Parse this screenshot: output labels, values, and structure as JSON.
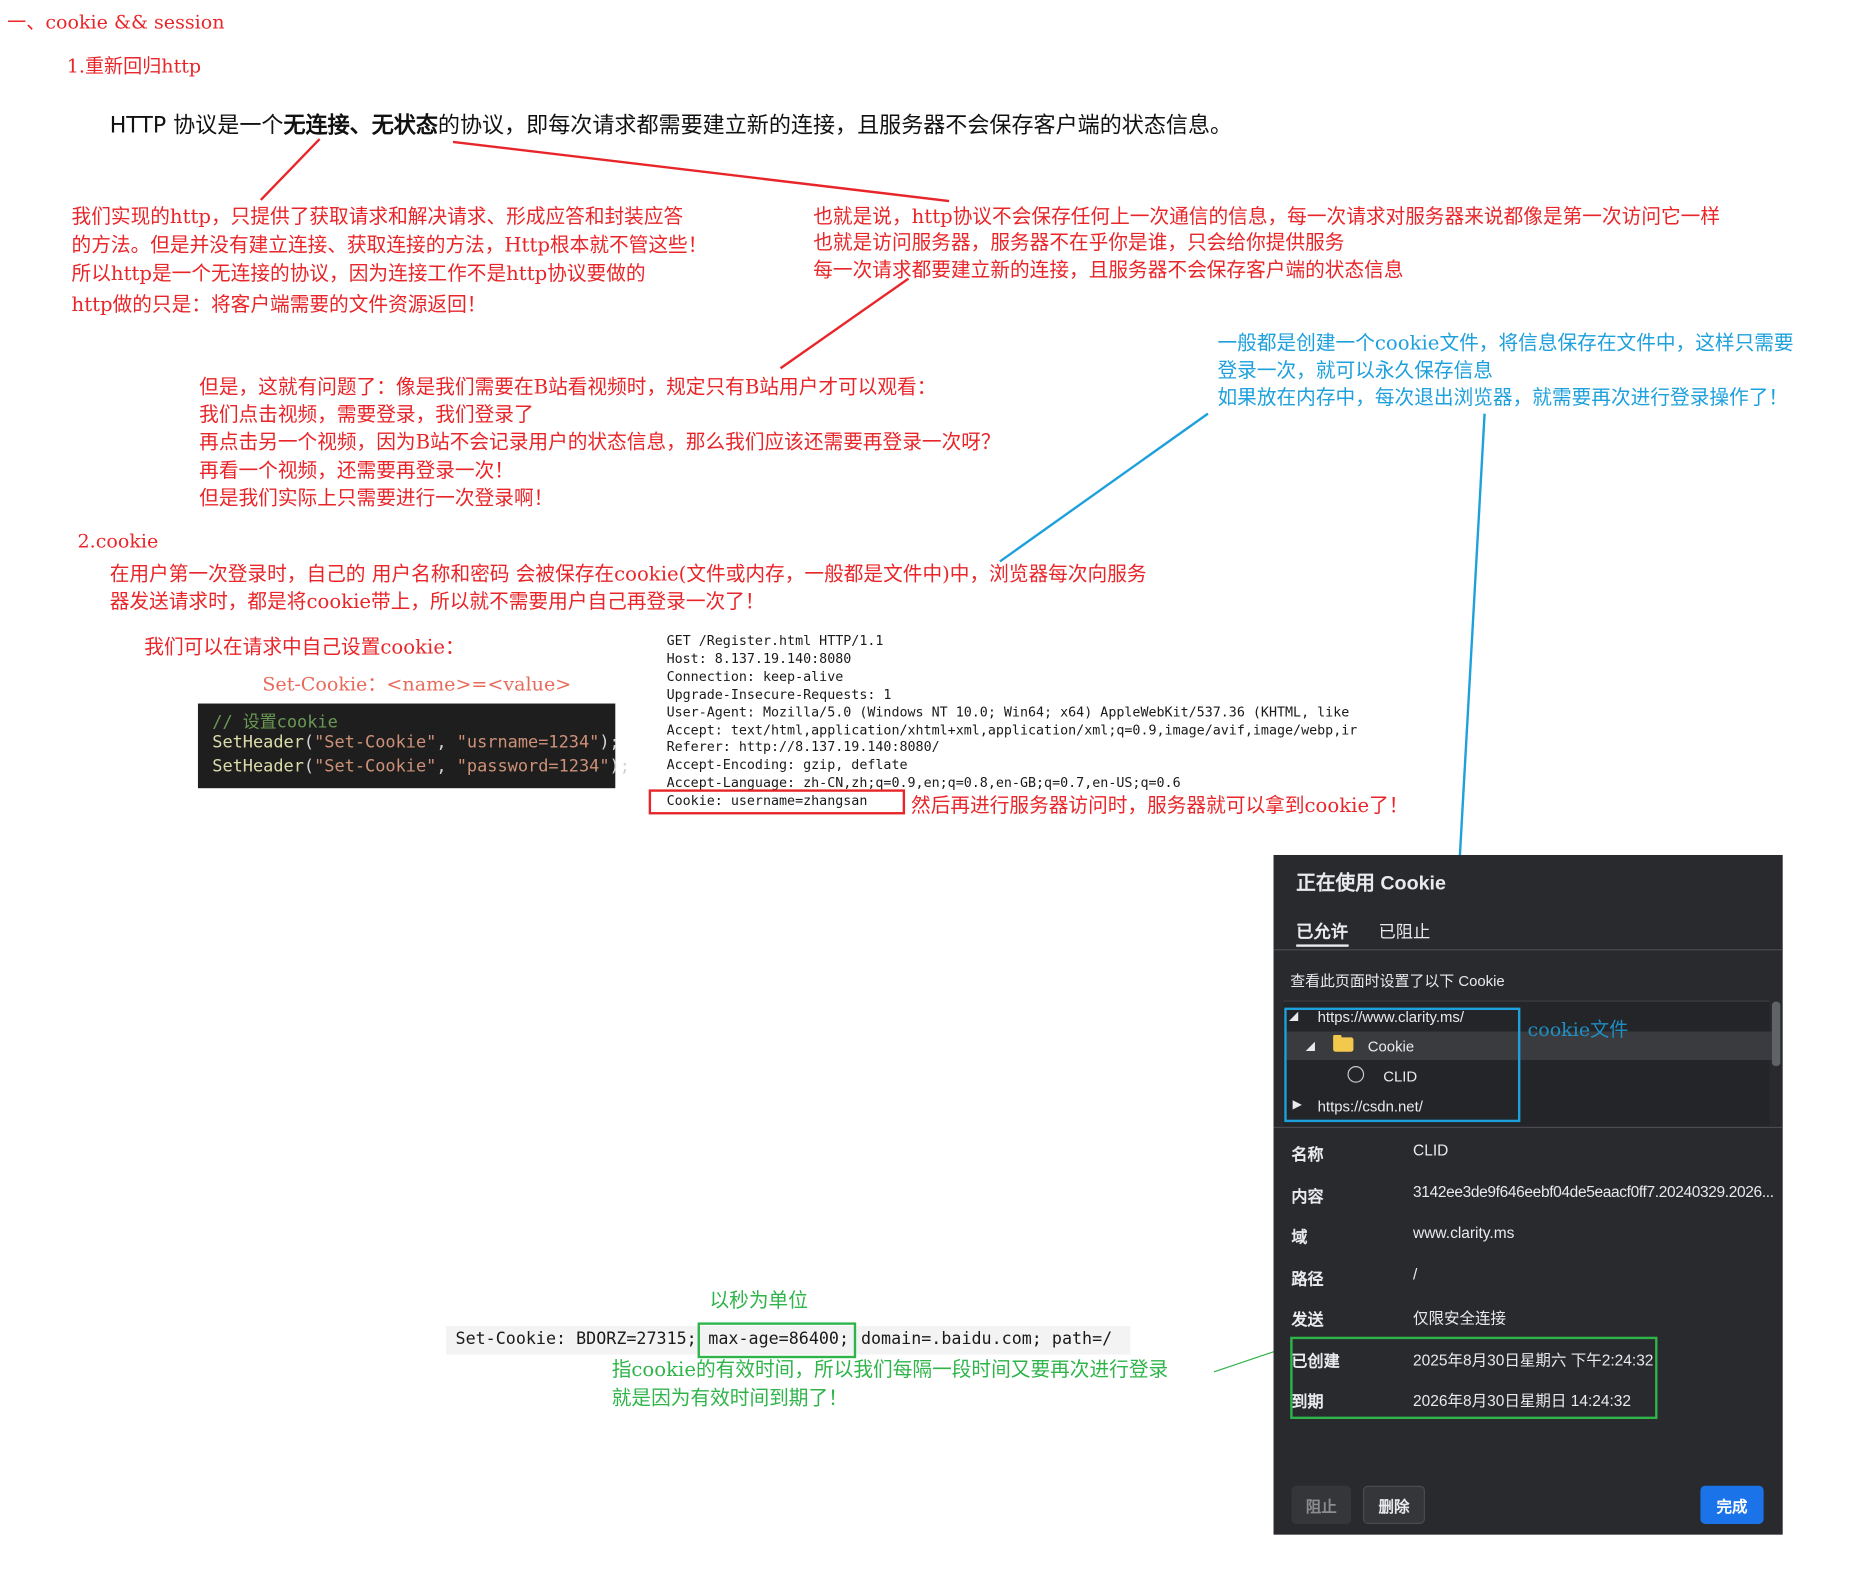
{
  "doc": {
    "heading": "一、cookie && session",
    "sub1": "1.重新回归http",
    "intro_a": "HTTP 协议是一个",
    "intro_b": "无连接、无状态",
    "intro_c": "的协议，即每次请求都需要建立新的连接，且服务器不会保存客户端的状态信息。",
    "note_left": [
      "我们实现的http，只提供了获取请求和解决请求、形成应答和封装应答",
      "的方法。但是并没有建立连接、获取连接的方法，Http根本就不管这些！",
      "所以http是一个无连接的协议，因为连接工作不是http协议要做的",
      "http做的只是：将客户端需要的文件资源返回！"
    ],
    "note_right": [
      "也就是说，http协议不会保存任何上一次通信的信息，每一次请求对服务器来说都像是第一次访问它一样",
      "也就是访问服务器，服务器不在乎你是谁，只会给你提供服务",
      "每一次请求都要建立新的连接，且服务器不会保存客户端的状态信息"
    ],
    "note_blue": [
      "一般都是创建一个cookie文件，将信息保存在文件中，这样只需要",
      "登录一次，就可以永久保存信息",
      "如果放在内存中，每次退出浏览器，就需要再次进行登录操作了！"
    ],
    "note_bili": [
      "但是，这就有问题了：像是我们需要在B站看视频时，规定只有B站用户才可以观看：",
      "我们点击视频，需要登录，我们登录了",
      "再点击另一个视频，因为B站不会记录用户的状态信息，那么我们应该还需要再登录一次呀？",
      "再看一个视频，还需要再登录一次！",
      "但是我们实际上只需要进行一次登录啊！"
    ],
    "sub2": "2.cookie",
    "cookie_desc": [
      "在用户第一次登录时，自己的 用户名称和密码 会被保存在cookie(文件或内存，一般都是文件中)中，浏览器每次向服务",
      "器发送请求时，都是将cookie带上，所以就不需要用户自己再登录一次了！"
    ],
    "set_self": "我们可以在请求中自己设置cookie：",
    "set_syntax": "Set-Cookie：<name>=<value>",
    "code": {
      "comment": "// 设置cookie",
      "fn": "SetHeader",
      "line2": [
        "(",
        "\"Set-Cookie\"",
        ", ",
        "\"usrname=1234\"",
        ");"
      ],
      "line3": [
        "(",
        "\"Set-Cookie\"",
        ", ",
        "\"password=1234\"",
        ");"
      ]
    },
    "http_request": [
      "GET /Register.html HTTP/1.1",
      "Host: 8.137.19.140:8080",
      "Connection: keep-alive",
      "Upgrade-Insecure-Requests: 1",
      "User-Agent: Mozilla/5.0 (Windows NT 10.0; Win64; x64) AppleWebKit/537.36 (KHTML, like",
      "Accept: text/html,application/xhtml+xml,application/xml;q=0.9,image/avif,image/webp,ir",
      "Referer: http://8.137.19.140:8080/",
      "Accept-Encoding: gzip, deflate",
      "Accept-Language: zh-CN,zh;q=0.9,en;q=0.8,en-GB;q=0.7,en-US;q=0.6",
      "Cookie: username=zhangsan"
    ],
    "after_note": "然后再进行服务器访问时，服务器就可以拿到cookie了！",
    "seconds_note": "以秒为单位",
    "set_cookie_line": {
      "a": "Set-Cookie: BDORZ=27315;",
      "b": "max-age=86400;",
      "c": "domain=.baidu.com; path=/"
    },
    "expire_note": [
      "指cookie的有效时间，所以我们每隔一段时间又要再次进行登录",
      "就是因为有效时间到期了！"
    ],
    "cookie_file_label": "cookie文件"
  },
  "devtools": {
    "title": "正在使用 Cookie",
    "tabs": [
      "已允许",
      "已阻止"
    ],
    "desc": "查看此页面时设置了以下 Cookie",
    "tree": {
      "site1": "https://www.clarity.ms/",
      "folder": "Cookie",
      "item": "CLID",
      "site2": "https://csdn.net/"
    },
    "fields": [
      {
        "label": "名称",
        "value": "CLID"
      },
      {
        "label": "内容",
        "value": "3142ee3de9f646eebf04de5eaacf0ff7.20240329.2026..."
      },
      {
        "label": "域",
        "value": "www.clarity.ms"
      },
      {
        "label": "路径",
        "value": "/"
      },
      {
        "label": "发送",
        "value": "仅限安全连接"
      },
      {
        "label": "已创建",
        "value": "2025年8月30日星期六 下午2:24:32"
      },
      {
        "label": "到期",
        "value": "2026年8月30日星期日 14:24:32"
      }
    ],
    "buttons": {
      "block": "阻止",
      "delete": "删除",
      "done": "完成"
    },
    "colors": {
      "bg": "#292a2d",
      "accent": "#1a73e8",
      "text": "#e8eaed"
    }
  }
}
